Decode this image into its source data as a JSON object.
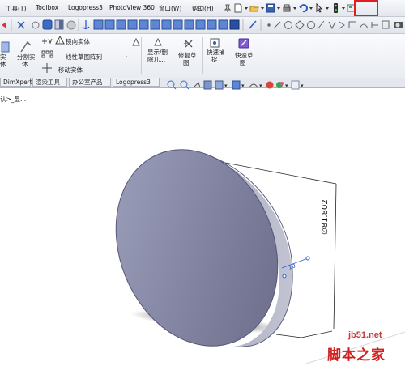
{
  "menubar": {
    "items": [
      {
        "label": "工具(T)"
      },
      {
        "label": "Toolbox"
      },
      {
        "label": "Logopress3"
      },
      {
        "label": "PhotoView 360"
      },
      {
        "label": "窗口(W)"
      },
      {
        "label": "帮助(H)"
      }
    ],
    "highlight_color": "#e02020"
  },
  "command_manager": {
    "group1": {
      "mirror": "镜向实体",
      "linear_pattern": "线性草图阵列",
      "move": "移动实体"
    },
    "cut_left": [
      "实",
      "体"
    ],
    "split": [
      "分割实",
      "体"
    ],
    "show_delete": [
      "显示/删",
      "除几..."
    ],
    "repair_sketch": [
      "修复草",
      "图"
    ],
    "quick_snap": [
      "快速捕",
      "捉"
    ],
    "rapid_sketch": [
      "快速草",
      "图"
    ]
  },
  "tabs": [
    {
      "label": "DimXpert"
    },
    {
      "label": "渲染工具"
    },
    {
      "label": "办公室产品"
    },
    {
      "label": "Logopress3"
    }
  ],
  "feature_tree": {
    "text": "认>_显..."
  },
  "model": {
    "dimension_diameter": "∅81.802",
    "dimension_small": "10",
    "body_color": "#8a8ca8",
    "edge_color": "#a9abbd"
  },
  "watermark": {
    "url": "jb51.net",
    "name": "脚本之家"
  }
}
